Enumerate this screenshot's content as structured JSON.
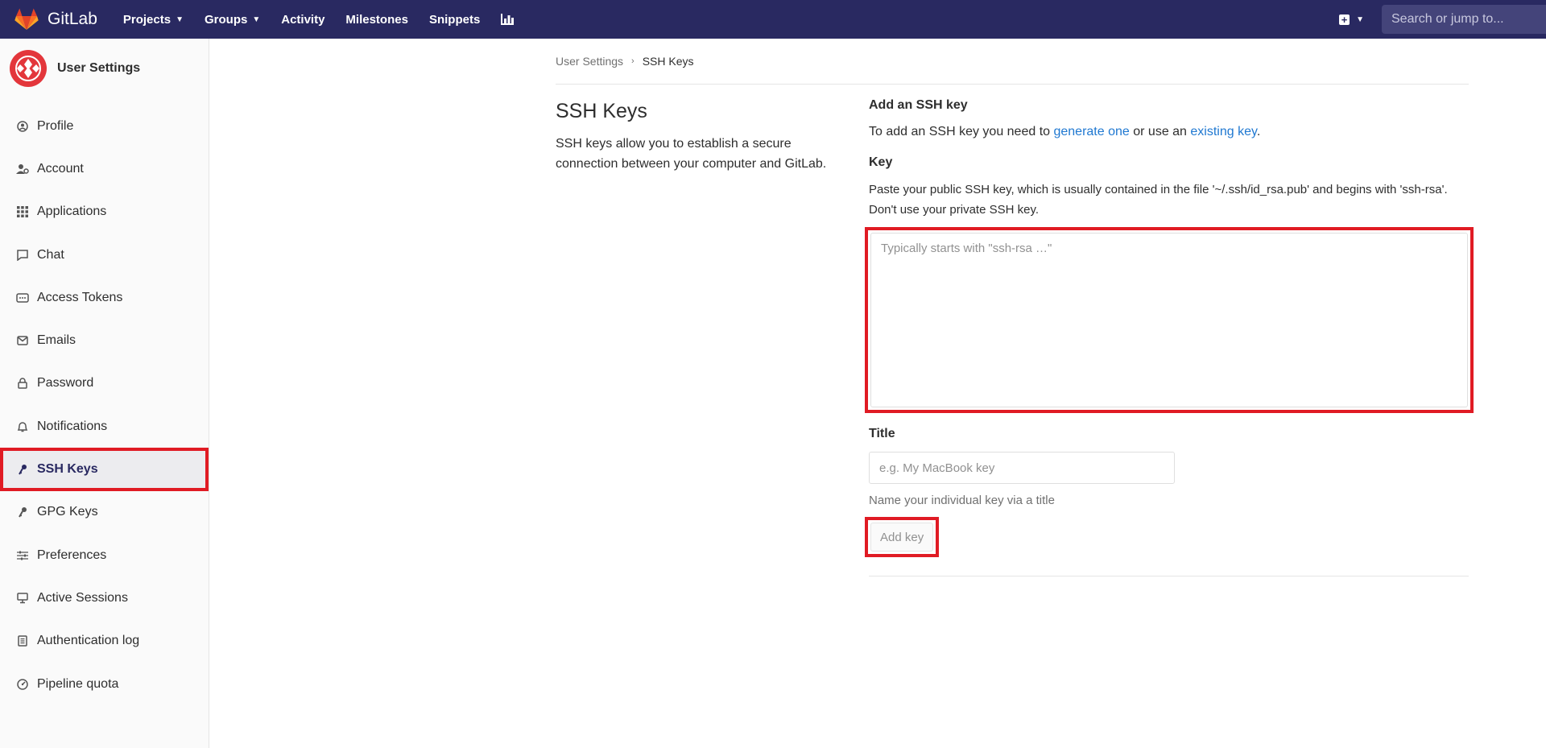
{
  "topnav": {
    "brand": "GitLab",
    "links": [
      {
        "label": "Projects",
        "dropdown": true
      },
      {
        "label": "Groups",
        "dropdown": true
      },
      {
        "label": "Activity",
        "dropdown": false
      },
      {
        "label": "Milestones",
        "dropdown": false
      },
      {
        "label": "Snippets",
        "dropdown": false
      }
    ],
    "search_placeholder": "Search or jump to...",
    "colors": {
      "bar": "#292961"
    }
  },
  "sidebar": {
    "title": "User Settings",
    "items": [
      {
        "label": "Profile",
        "icon": "profile-icon"
      },
      {
        "label": "Account",
        "icon": "account-icon"
      },
      {
        "label": "Applications",
        "icon": "applications-icon"
      },
      {
        "label": "Chat",
        "icon": "chat-icon"
      },
      {
        "label": "Access Tokens",
        "icon": "token-icon"
      },
      {
        "label": "Emails",
        "icon": "email-icon"
      },
      {
        "label": "Password",
        "icon": "lock-icon"
      },
      {
        "label": "Notifications",
        "icon": "bell-icon"
      },
      {
        "label": "SSH Keys",
        "icon": "key-icon",
        "active": true
      },
      {
        "label": "GPG Keys",
        "icon": "key-icon"
      },
      {
        "label": "Preferences",
        "icon": "sliders-icon"
      },
      {
        "label": "Active Sessions",
        "icon": "monitor-icon"
      },
      {
        "label": "Authentication log",
        "icon": "log-icon"
      },
      {
        "label": "Pipeline quota",
        "icon": "gauge-icon"
      }
    ]
  },
  "breadcrumb": {
    "parent": "User Settings",
    "current": "SSH Keys"
  },
  "left": {
    "title": "SSH Keys",
    "description": "SSH keys allow you to establish a secure connection between your computer and GitLab."
  },
  "form": {
    "heading": "Add an SSH key",
    "intro_before": "To add an SSH key you need to ",
    "intro_link1": "generate one",
    "intro_middle": " or use an ",
    "intro_link2": "existing key",
    "intro_after": ".",
    "key_label": "Key",
    "key_help": "Paste your public SSH key, which is usually contained in the file '~/.ssh/id_rsa.pub' and begins with 'ssh-rsa'. Don't use your private SSH key.",
    "key_placeholder": "Typically starts with \"ssh-rsa …\"",
    "title_label": "Title",
    "title_placeholder": "e.g. My MacBook key",
    "title_help": "Name your individual key via a title",
    "submit_label": "Add key"
  }
}
